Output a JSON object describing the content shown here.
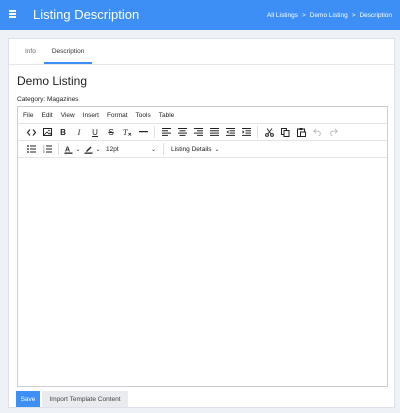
{
  "header": {
    "title": "Listing Description",
    "breadcrumbs": [
      "All Listings",
      "Demo Listing",
      "Description"
    ],
    "separator": ">"
  },
  "tabs": [
    {
      "label": "Info",
      "active": false
    },
    {
      "label": "Description",
      "active": true
    }
  ],
  "listing": {
    "title": "Demo Listing",
    "category_label": "Category:",
    "category_value": "Magazines"
  },
  "editor": {
    "menus": [
      "File",
      "Edit",
      "View",
      "Insert",
      "Format",
      "Tools",
      "Table"
    ],
    "font_size": "12pt",
    "custom_menu": "Listing Details"
  },
  "actions": {
    "save": "Save",
    "import": "Import Template Content"
  },
  "colors": {
    "accent": "#3d8ff5"
  }
}
